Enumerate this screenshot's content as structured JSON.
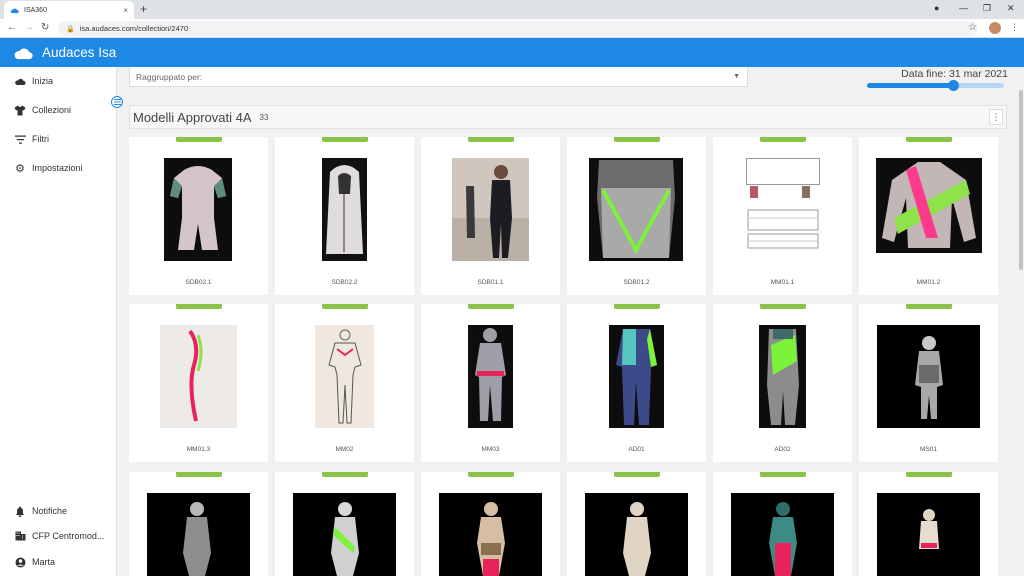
{
  "browser": {
    "tab_title": "ISA360",
    "tab_close": "×",
    "new_tab": "+",
    "url": "isa.audaces.com/collection/2470",
    "window_buttons": [
      "●",
      "—",
      "❐",
      "✕"
    ]
  },
  "app": {
    "title": "Audaces Isa",
    "accent": "#1e88e5"
  },
  "sidebar": {
    "items": [
      {
        "label": "Inizia",
        "icon": "cloud-icon"
      },
      {
        "label": "Collezioni",
        "icon": "shirt-icon"
      },
      {
        "label": "Filtri",
        "icon": "filter-icon"
      },
      {
        "label": "Impostazioni",
        "icon": "gear-icon"
      }
    ],
    "bottom_items": [
      {
        "label": "Notifiche",
        "icon": "bell-icon"
      },
      {
        "label": "CFP Centromod...",
        "icon": "building-icon"
      },
      {
        "label": "Marta",
        "icon": "user-icon"
      }
    ]
  },
  "filters": {
    "group_by_label": "Raggruppato per:",
    "date_end": "Data fine: 31 mar 2021",
    "slider_level": 0.63
  },
  "section": {
    "title": "Modelli Approvati 4A",
    "count": "33",
    "menu": "⋮"
  },
  "cards": [
    {
      "label": "SDB02.1",
      "status_color": "#8bc34a"
    },
    {
      "label": "SDB02.2",
      "status_color": "#8bc34a"
    },
    {
      "label": "SDB01.1",
      "status_color": "#8bc34a"
    },
    {
      "label": "SDB01.2",
      "status_color": "#8bc34a"
    },
    {
      "label": "MM01.1",
      "status_color": "#8bc34a"
    },
    {
      "label": "MM01.2",
      "status_color": "#8bc34a"
    },
    {
      "label": "MM01.3",
      "status_color": "#8bc34a"
    },
    {
      "label": "MM02",
      "status_color": "#8bc34a"
    },
    {
      "label": "MM03",
      "status_color": "#8bc34a"
    },
    {
      "label": "AD01",
      "status_color": "#8bc34a"
    },
    {
      "label": "AD02",
      "status_color": "#8bc34a"
    },
    {
      "label": "MS01",
      "status_color": "#8bc34a"
    },
    {
      "label": "",
      "status_color": "#8bc34a"
    },
    {
      "label": "",
      "status_color": "#8bc34a"
    },
    {
      "label": "",
      "status_color": "#8bc34a"
    },
    {
      "label": "",
      "status_color": "#8bc34a"
    },
    {
      "label": "",
      "status_color": "#8bc34a"
    },
    {
      "label": "",
      "status_color": "#8bc34a"
    }
  ]
}
